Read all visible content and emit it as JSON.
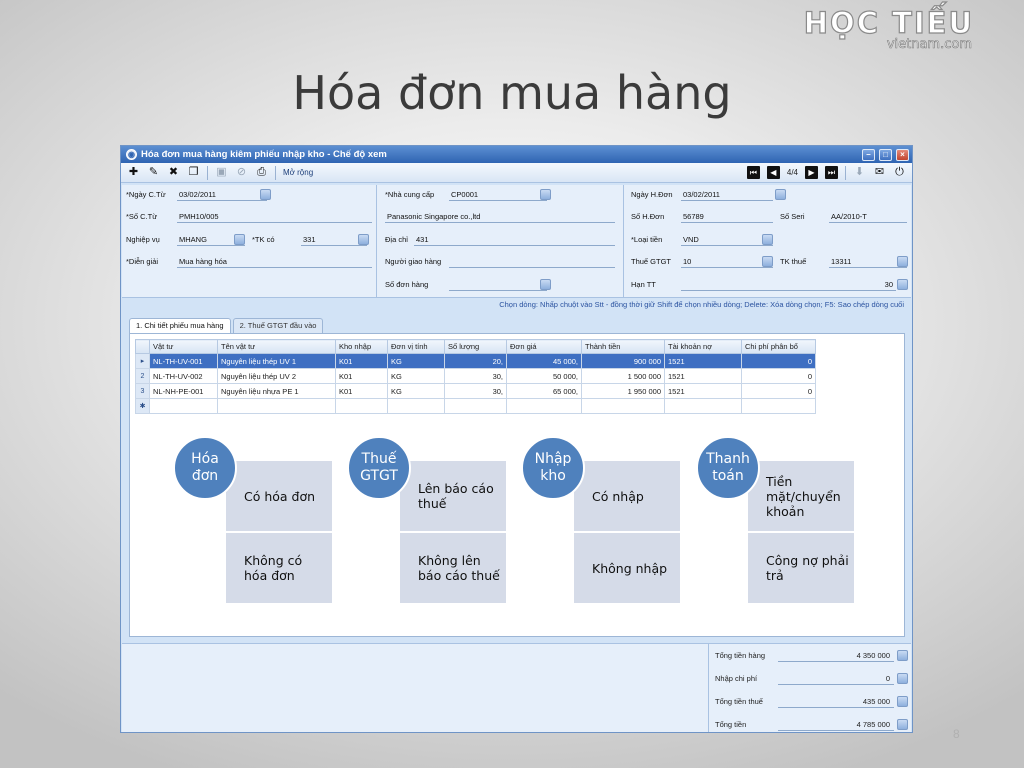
{
  "slide": {
    "title": "Hóa đơn mua hàng",
    "page_number": "8"
  },
  "logo": {
    "line1": "HỌC TIẾU",
    "line2": "vietnam.com"
  },
  "window": {
    "title": "Hóa đơn mua hàng kiêm phiếu nhập kho - Chế độ xem"
  },
  "toolbar": {
    "expand_label": "Mở rộng",
    "record_counter": "4/4"
  },
  "form": {
    "col1": {
      "ngay_ct_label": "*Ngày C.Từ",
      "ngay_ct_value": "03/02/2011",
      "so_ct_label": "*Số C.Từ",
      "so_ct_value": "PMH10/005",
      "nghiep_vu_label": "Nghiệp vụ",
      "nghiep_vu_value": "MHANG",
      "tk_co_label": "*TK có",
      "tk_co_value": "331",
      "dien_giai_label": "*Diễn giải",
      "dien_giai_value": "Mua hàng hóa"
    },
    "col2": {
      "ncc_label": "*Nhà cung cấp",
      "ncc_value": "CP0001",
      "ncc_name": "Panasonic Singapore co.,ltd",
      "dia_chi_label": "Địa chỉ",
      "dia_chi_value": "431",
      "nguoi_giao_label": "Người giao hàng",
      "nguoi_giao_value": "",
      "so_don_hang_label": "Số đơn hàng",
      "so_don_hang_value": ""
    },
    "col3": {
      "ngay_hd_label": "Ngày H.Đơn",
      "ngay_hd_value": "03/02/2011",
      "so_hd_label": "Số H.Đơn",
      "so_hd_value": "56789",
      "so_seri_label": "Số Seri",
      "so_seri_value": "AA/2010-T",
      "loai_tien_label": "*Loại tiền",
      "loai_tien_value": "VND",
      "thue_gtgt_label": "Thuế GTGT",
      "thue_gtgt_value": "10",
      "tk_thue_label": "TK thuế",
      "tk_thue_value": "13311",
      "han_tt_label": "Hạn TT",
      "han_tt_value": "30"
    }
  },
  "hint": "Chọn dòng: Nhấp chuột vào Stt - đồng thời giữ Shift để chọn nhiều dòng; Delete: Xóa dòng chọn; F5: Sao chép dòng cuối",
  "tabs": [
    {
      "label": "1. Chi tiết phiếu mua hàng"
    },
    {
      "label": "2. Thuế GTGT đầu vào"
    }
  ],
  "grid": {
    "columns": [
      "Vật tư",
      "Tên vật tư",
      "Kho nhập",
      "Đơn vị tính",
      "Số lượng",
      "Đơn giá",
      "Thành tiền",
      "Tài khoản nợ",
      "Chi phí phân bổ"
    ],
    "rows": [
      {
        "marker": "▸",
        "cells": [
          "NL-TH-UV-001",
          "Nguyên liệu thép UV 1",
          "K01",
          "KG",
          "20,",
          "45 000,",
          "900 000",
          "1521",
          "0"
        ]
      },
      {
        "marker": "2",
        "cells": [
          "NL-TH-UV-002",
          "Nguyên liệu thép UV 2",
          "K01",
          "KG",
          "30,",
          "50 000,",
          "1 500 000",
          "1521",
          "0"
        ]
      },
      {
        "marker": "3",
        "cells": [
          "NL-NH-PE-001",
          "Nguyên liệu nhựa PE 1",
          "K01",
          "KG",
          "30,",
          "65 000,",
          "1 950 000",
          "1521",
          "0"
        ]
      },
      {
        "marker": "✱",
        "cells": [
          "",
          "",
          "",
          "",
          "",
          "",
          "",
          "",
          ""
        ]
      }
    ]
  },
  "diagram": [
    {
      "circle": "Hóa đơn",
      "top": "Có hóa đơn",
      "bottom": "Không có hóa đơn"
    },
    {
      "circle": "Thuế GTGT",
      "top": "Lên báo cáo thuế",
      "bottom": "Không lên báo cáo thuế"
    },
    {
      "circle": "Nhập kho",
      "top": "Có nhập",
      "bottom": "Không nhập"
    },
    {
      "circle": "Thanh toán",
      "top": "Tiền mặt/chuyển khoản",
      "bottom": "Công nợ phải trả"
    }
  ],
  "summary": [
    {
      "label": "Tổng tiền hàng",
      "value": "4 350 000"
    },
    {
      "label": "Nhập chi phí",
      "value": "0"
    },
    {
      "label": "Tổng tiền thuế",
      "value": "435 000"
    },
    {
      "label": "Tổng tiền",
      "value": "4 785 000"
    }
  ]
}
